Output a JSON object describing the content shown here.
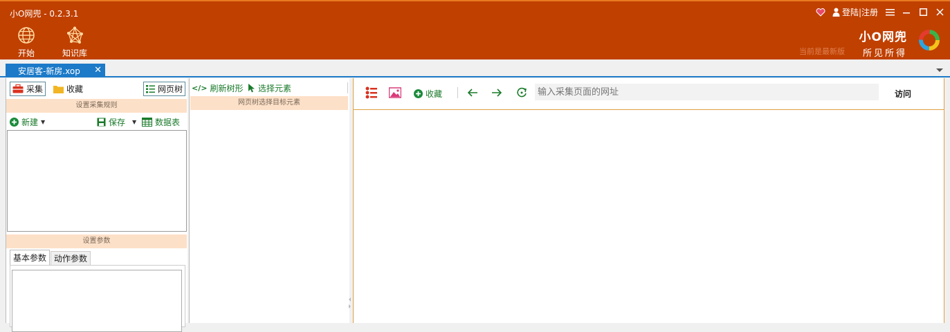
{
  "app": {
    "title": "小O网兜 - 0.2.3.1",
    "login_label": "登陆|注册",
    "brand_name": "小O网兜",
    "brand_slogan": "所见所得",
    "update_note": "当前是最新版",
    "colors": {
      "titlebar": "#c04000",
      "accent_blue": "#1c7ac8",
      "band": "#fde0c8",
      "green": "#1a7a2a"
    }
  },
  "toolbar": {
    "start_label": "开始",
    "start_icon": "globe-icon",
    "kb_label": "知识库",
    "kb_icon": "network-icon"
  },
  "tabs": [
    {
      "label": "安居客-新房.xop",
      "active": true
    }
  ],
  "left_panel": {
    "collect_label": "采集",
    "favorites_label": "收藏",
    "webtree_label": "网页树",
    "rule_band": "设置采集规则",
    "new_label": "新建",
    "save_label": "保存",
    "datatable_label": "数据表",
    "param_band": "设置参数",
    "subtabs": [
      "基本参数",
      "动作参数"
    ]
  },
  "mid_panel": {
    "refresh_label": "刷新树形",
    "select_label": "选择元素",
    "hint_band": "网页树选择目标元素"
  },
  "browser": {
    "favorite_label": "收藏",
    "url_placeholder": "输入采集页面的网址",
    "url_value": "",
    "visit_label": "访问"
  }
}
